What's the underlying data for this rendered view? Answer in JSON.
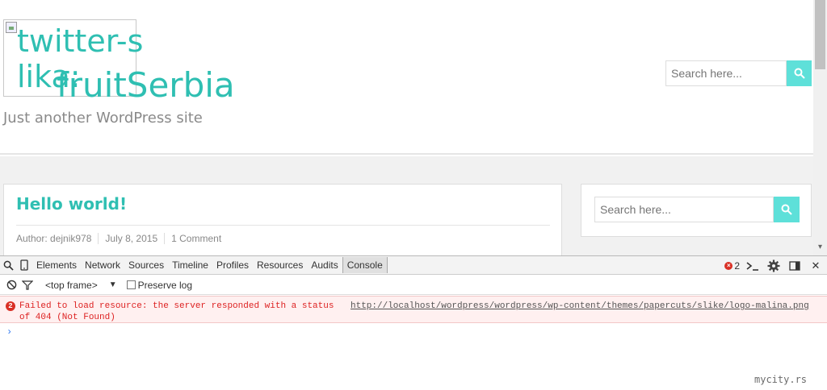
{
  "site": {
    "logo_alt": "twitter-slika:",
    "title": "fruitSerbia",
    "description": "Just another WordPress site"
  },
  "header_search": {
    "placeholder": "Search here...",
    "icon": "search-icon"
  },
  "post": {
    "title": "Hello world!",
    "author": "Author: dejnik978",
    "date": "July 8, 2015",
    "comments": "1 Comment"
  },
  "sidebar_search": {
    "placeholder": "Search here...",
    "icon": "search-icon"
  },
  "devtools": {
    "tabs": [
      "Elements",
      "Network",
      "Sources",
      "Timeline",
      "Profiles",
      "Resources",
      "Audits",
      "Console"
    ],
    "active_tab": "Console",
    "error_count": "2",
    "frame": "<top frame>",
    "preserve_log_label": "Preserve log",
    "error": {
      "count": "2",
      "message": "Failed to load resource: the server responded with a status of 404 (Not Found)",
      "url": "http://localhost/wordpress/wordpress/wp-content/themes/papercuts/slike/logo-malina.png"
    },
    "prompt": "›"
  },
  "watermark": "mycity.rs",
  "colors": {
    "accent": "#2fbfb2",
    "search_button": "#5ee0d9",
    "error": "#d93025"
  }
}
